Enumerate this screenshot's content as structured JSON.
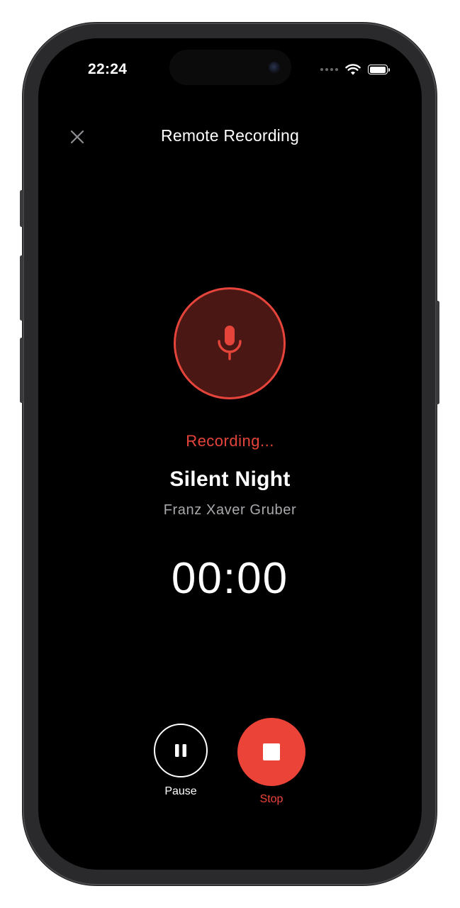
{
  "status_bar": {
    "time": "22:24",
    "battery_level": 1.0
  },
  "header": {
    "title": "Remote Recording",
    "close_icon": "close-icon"
  },
  "recorder": {
    "mic_icon": "microphone-icon",
    "status": "Recording...",
    "song_title": "Silent Night",
    "artist": "Franz Xaver Gruber",
    "elapsed": "00:00"
  },
  "controls": {
    "pause_label": "Pause",
    "pause_icon": "pause-icon",
    "stop_label": "Stop",
    "stop_icon": "stop-icon"
  },
  "colors": {
    "accent_red": "#ec4339",
    "mic_fill": "#4a1714",
    "background": "#000000",
    "secondary_text": "#a9a9ad"
  }
}
